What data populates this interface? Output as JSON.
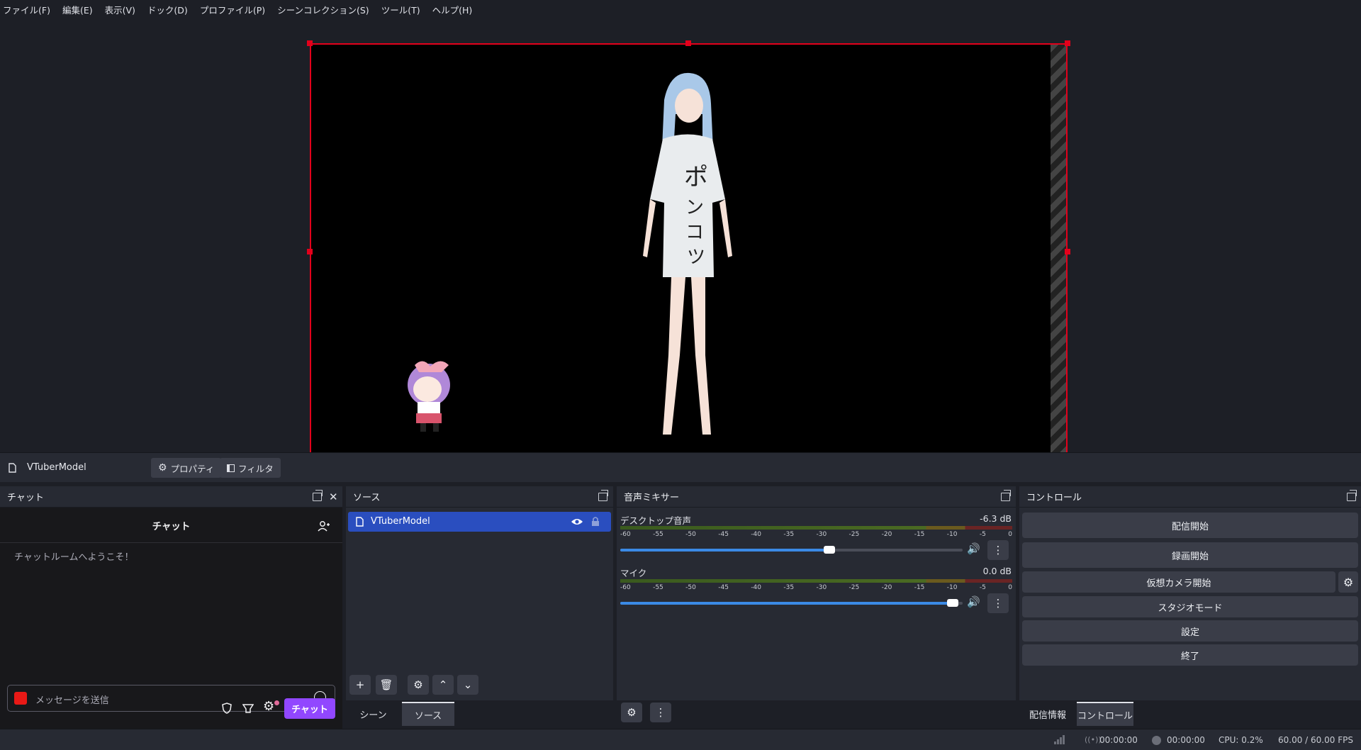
{
  "menu": [
    "ファイル(F)",
    "編集(E)",
    "表示(V)",
    "ドック(D)",
    "プロファイル(P)",
    "シーンコレクション(S)",
    "ツール(T)",
    "ヘルプ(H)"
  ],
  "source_toolbar": {
    "source_name": "VTuberModel",
    "properties": "プロパティ",
    "filters": "フィルタ"
  },
  "chat": {
    "title": "チャット",
    "header": "チャット",
    "welcome": "チャットルームへようこそ！",
    "input_placeholder": "メッセージを送信",
    "send": "チャット"
  },
  "sources": {
    "title": "ソース",
    "items": [
      {
        "name": "VTuberModel"
      }
    ],
    "tabs": [
      "シーン",
      "ソース"
    ]
  },
  "mixer": {
    "title": "音声ミキサー",
    "ticks": [
      "-60",
      "-55",
      "-50",
      "-45",
      "-40",
      "-35",
      "-30",
      "-25",
      "-20",
      "-15",
      "-10",
      "-5",
      "0"
    ],
    "channels": [
      {
        "name": "デスクトップ音声",
        "db": "-6.3 dB",
        "level": 0.61
      },
      {
        "name": "マイク",
        "db": "0.0 dB",
        "level": 0.97
      }
    ]
  },
  "controls": {
    "title": "コントロール",
    "buttons": [
      "配信開始",
      "録画開始",
      "仮想カメラ開始",
      "スタジオモード",
      "設定",
      "終了"
    ],
    "tabs": [
      "配信情報",
      "コントロール"
    ]
  },
  "status": {
    "stream_time": "00:00:00",
    "rec_time": "00:00:00",
    "cpu": "CPU: 0.2%",
    "fps": "60.00 / 60.00 FPS"
  },
  "colors": {
    "accent": "#2a4ebf",
    "selection_border": "#e3001b",
    "chat_button": "#9147ff"
  }
}
